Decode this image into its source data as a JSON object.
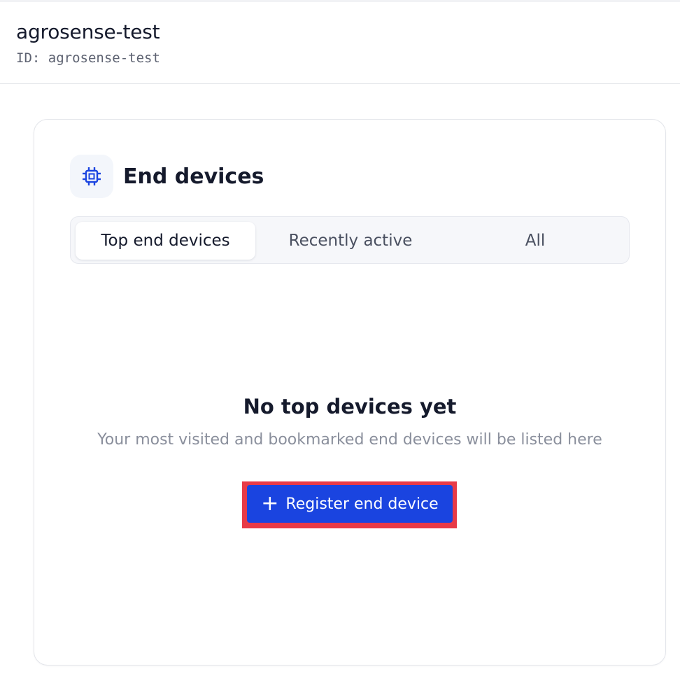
{
  "header": {
    "title": "agrosense-test",
    "id_label": "ID:",
    "id_value": "agrosense-test"
  },
  "card": {
    "icon": "chip-icon",
    "title": "End devices",
    "tabs": [
      {
        "label": "Top end devices",
        "active": true
      },
      {
        "label": "Recently active",
        "active": false
      },
      {
        "label": "All",
        "active": false
      }
    ],
    "empty_state": {
      "title": "No top devices yet",
      "subtitle": "Your most visited and bookmarked end devices will be listed here"
    },
    "register_button": {
      "icon": "plus-icon",
      "label": "Register end device"
    }
  },
  "colors": {
    "accent": "#1a44e0",
    "highlight": "#e83a47",
    "text_primary": "#151a2c",
    "text_muted": "#8a8f9c"
  }
}
